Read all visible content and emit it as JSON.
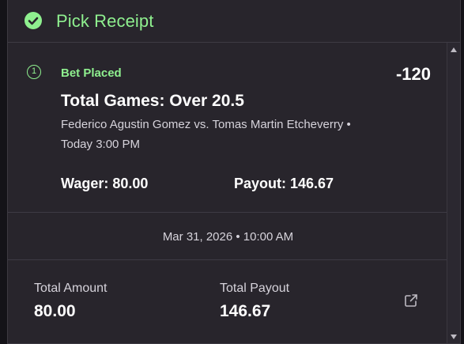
{
  "header": {
    "title": "Pick Receipt",
    "icon": "check-circle-icon",
    "accent_color": "#8ff08f"
  },
  "bet": {
    "leg_number": "1",
    "status": "Bet Placed",
    "odds": "-120",
    "market": "Total Games: Over 20.5",
    "event_line1": "Federico Agustin Gomez vs. Tomas Martin Etcheverry •",
    "event_line2": "Today 3:00 PM",
    "wager": "Wager: 80.00",
    "payout": "Payout: 146.67"
  },
  "timestamp": "Mar 31, 2026 • 10:00 AM",
  "totals": {
    "amount_label": "Total Amount",
    "amount_value": "80.00",
    "payout_label": "Total Payout",
    "payout_value": "146.67",
    "share_icon": "external-link-icon"
  }
}
